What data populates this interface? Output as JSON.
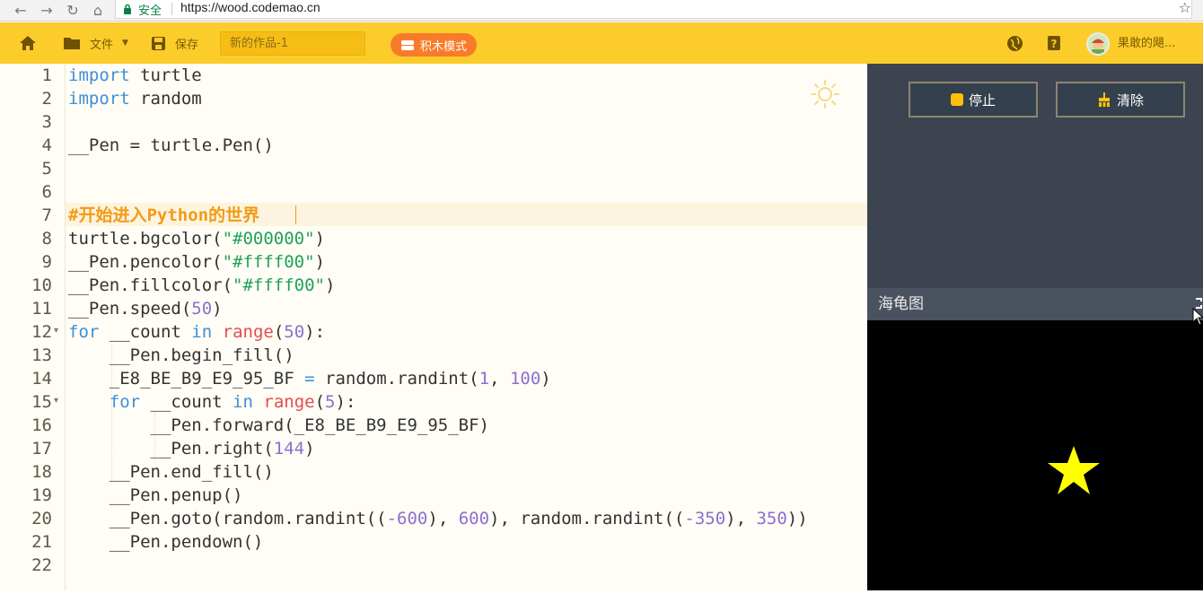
{
  "browser": {
    "secure_label": "安全",
    "url": "https://wood.codemao.cn"
  },
  "toolbar": {
    "file_label": "文件",
    "save_label": "保存",
    "project_name": "新的作品-1",
    "block_mode_label": "积木模式",
    "username": "果敢的飓..."
  },
  "editor": {
    "line_numbers": [
      "1",
      "2",
      "3",
      "4",
      "5",
      "6",
      "7",
      "8",
      "9",
      "10",
      "11",
      "12",
      "13",
      "14",
      "15",
      "16",
      "17",
      "18",
      "19",
      "20",
      "21",
      "22"
    ],
    "active_line": 7
  },
  "panel": {
    "stop_label": "停止",
    "clear_label": "清除",
    "turtle_title": "海龟图"
  },
  "colors": {
    "toolbar": "#fccd2a",
    "accent_button": "#f87b2b",
    "star": "#ffff00",
    "canvas_bg": "#000000"
  }
}
